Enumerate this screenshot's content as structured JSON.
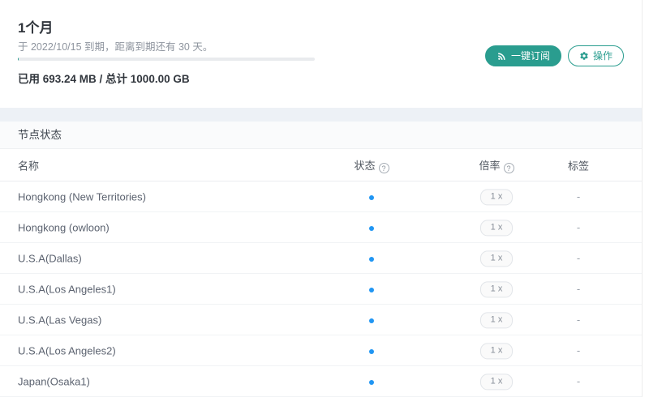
{
  "colors": {
    "accent_teal": "#2a9d8f",
    "status_dot_blue": "#2196f3",
    "progress_track": "#e9ebee"
  },
  "subscription": {
    "plan_name": "1个月",
    "expiry_text": "于 2022/10/15 到期，距离到期还有 30 天。",
    "usage_text": "已用 693.24 MB / 总计 1000.00 GB",
    "used": "693.24 MB",
    "total": "1000.00 GB",
    "progress_percent": 0.07,
    "subscribe_button": "一键订阅",
    "actions_button": "操作"
  },
  "node_status": {
    "section_title": "节点状态",
    "columns": {
      "name": "名称",
      "status": "状态",
      "rate": "倍率",
      "tag": "标签"
    },
    "rows": [
      {
        "name": "Hongkong (New Territories)",
        "status": "online",
        "rate": "1 x",
        "tag": "-"
      },
      {
        "name": "Hongkong (owloon)",
        "status": "online",
        "rate": "1 x",
        "tag": "-"
      },
      {
        "name": "U.S.A(Dallas)",
        "status": "online",
        "rate": "1 x",
        "tag": "-"
      },
      {
        "name": "U.S.A(Los Angeles1)",
        "status": "online",
        "rate": "1 x",
        "tag": "-"
      },
      {
        "name": "U.S.A(Las Vegas)",
        "status": "online",
        "rate": "1 x",
        "tag": "-"
      },
      {
        "name": "U.S.A(Los Angeles2)",
        "status": "online",
        "rate": "1 x",
        "tag": "-"
      },
      {
        "name": "Japan(Osaka1)",
        "status": "online",
        "rate": "1 x",
        "tag": "-"
      }
    ]
  }
}
